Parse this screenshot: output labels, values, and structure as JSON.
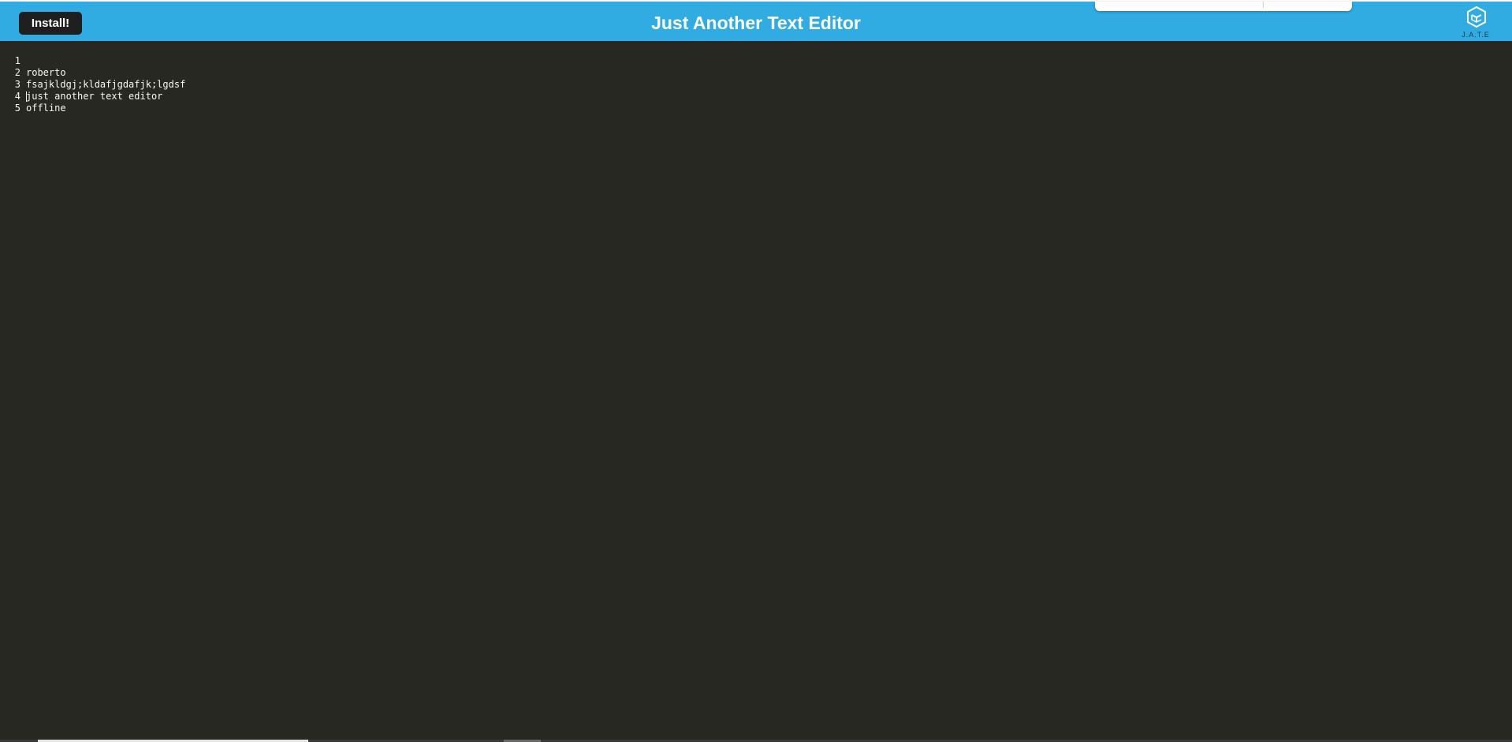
{
  "header": {
    "install_label": "Install!",
    "title": "Just Another Text Editor",
    "logo_text": "J.A.T.E",
    "logo_icon": "cube-icon",
    "background_color": "#31ace2"
  },
  "editor": {
    "theme_background": "#272822",
    "lines": [
      {
        "number": "1",
        "text": "roberto"
      },
      {
        "number": "2",
        "text": "fsajkldgj;kldafjgdafjk;lgdsf"
      },
      {
        "number": "3",
        "text": "just another text editor"
      },
      {
        "number": "4",
        "text": "offline"
      },
      {
        "number": "5",
        "text": ""
      }
    ]
  }
}
